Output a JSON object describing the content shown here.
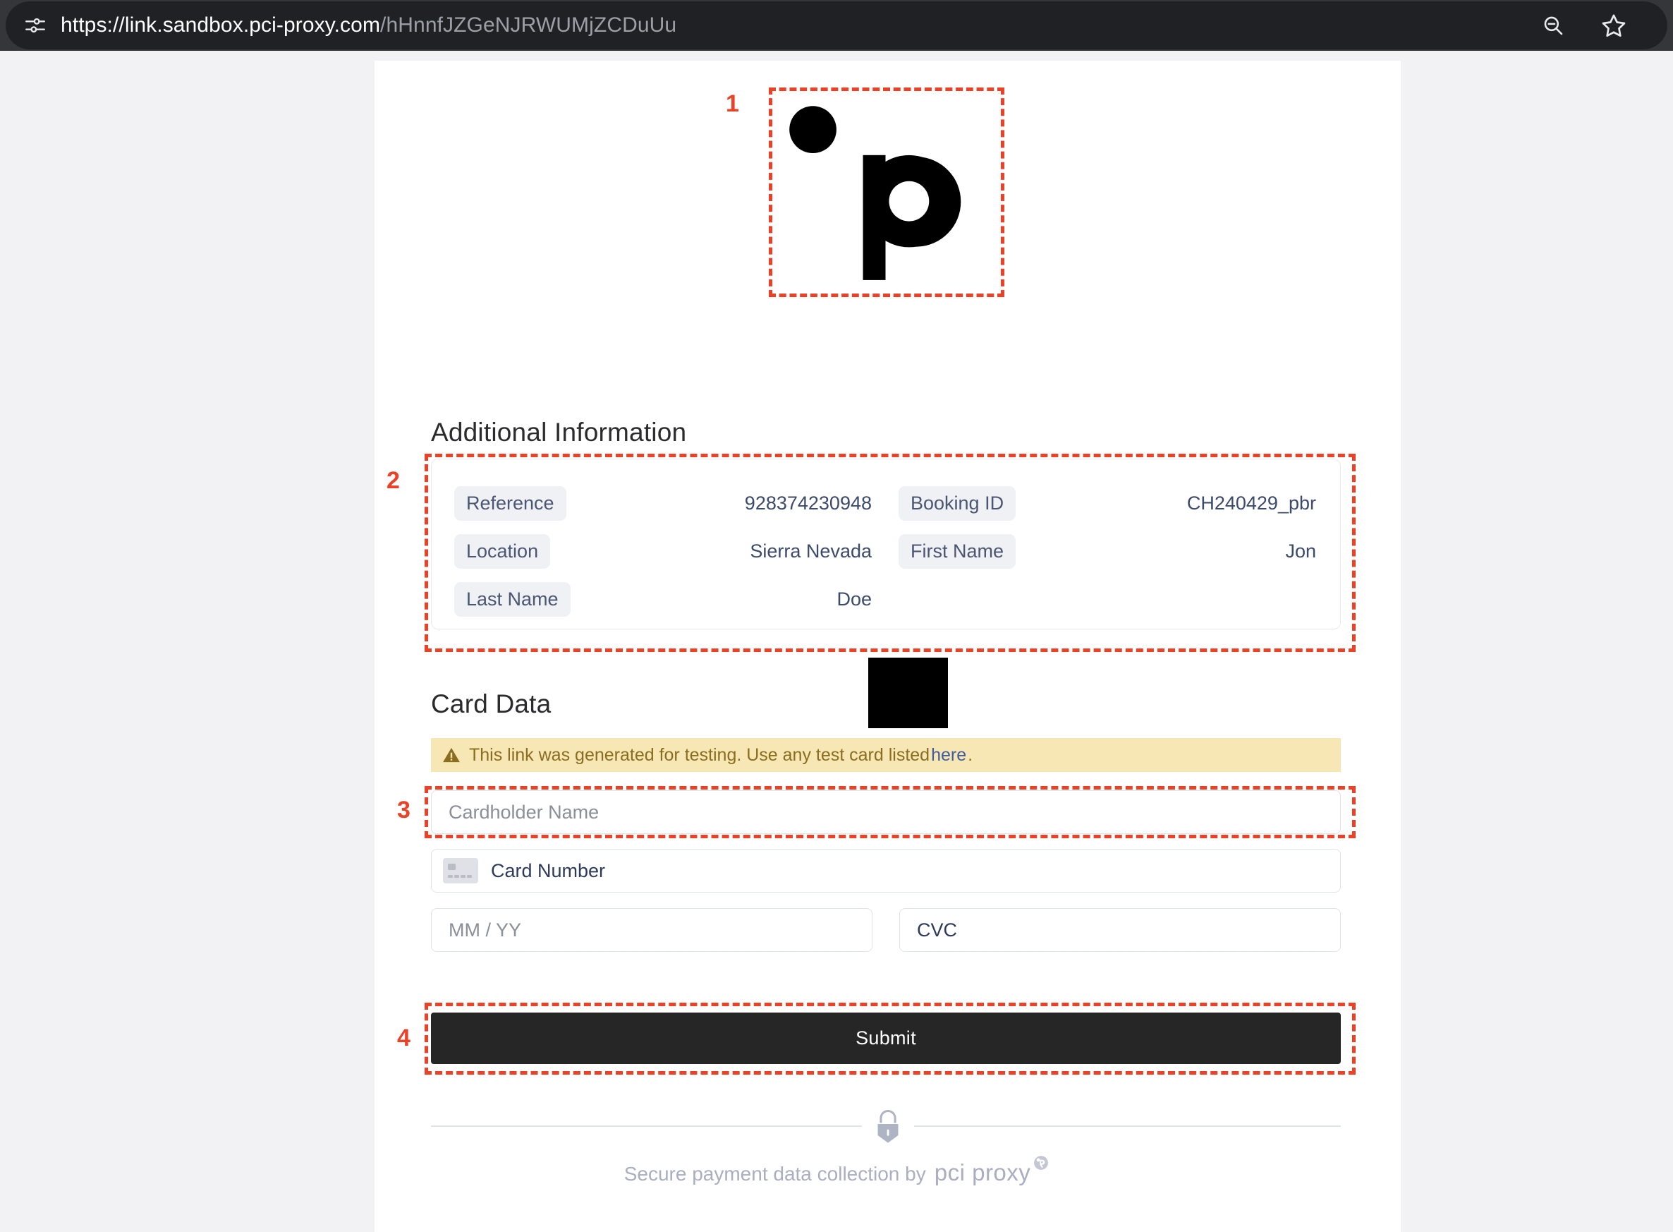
{
  "browser": {
    "url_origin": "https://link.sandbox.pci-proxy.com",
    "url_path": "/hHnnfJZGeNJRWUMjZCDuUu",
    "icon_site_settings": "site-settings-icon",
    "icon_zoom_out": "zoom-out-icon",
    "icon_bookmark": "bookmark-star-icon"
  },
  "brand": {
    "logo_alt": "pci-proxy-p-logo"
  },
  "additional_information": {
    "heading": "Additional Information",
    "fields": [
      {
        "label": "Reference",
        "value": "928374230948"
      },
      {
        "label": "Booking ID",
        "value": "CH240429_pbr"
      },
      {
        "label": "Location",
        "value": "Sierra Nevada"
      },
      {
        "label": "First Name",
        "value": "Jon"
      },
      {
        "label": "Last Name",
        "value": "Doe"
      }
    ]
  },
  "card_data": {
    "heading": "Card Data",
    "notice": {
      "icon": "warning-triangle-icon",
      "text_before": "This link was generated for testing. Use any test card listed",
      "link_text": "here",
      "text_after": "."
    },
    "fields": {
      "cardholder_placeholder": "Cardholder Name",
      "cardnumber_placeholder": "Card Number",
      "expiry_placeholder": "MM / YY",
      "cvc_placeholder": "CVC"
    },
    "submit_label": "Submit"
  },
  "footer": {
    "lock_icon": "lock-icon",
    "text": "Secure payment data collection by",
    "brand": "pci proxy",
    "registered_mark": "®"
  },
  "annotations": {
    "one": "1",
    "two": "2",
    "three": "3",
    "four": "4"
  },
  "colors": {
    "accent_annotation": "#ea4127",
    "notice_bg": "#f7e7b4",
    "notice_text": "#8a6d1f",
    "link": "#3f5d9e",
    "submit_bg": "#262626",
    "label_pill_bg": "#f0f1f5",
    "value_text": "#3c4a6b"
  }
}
